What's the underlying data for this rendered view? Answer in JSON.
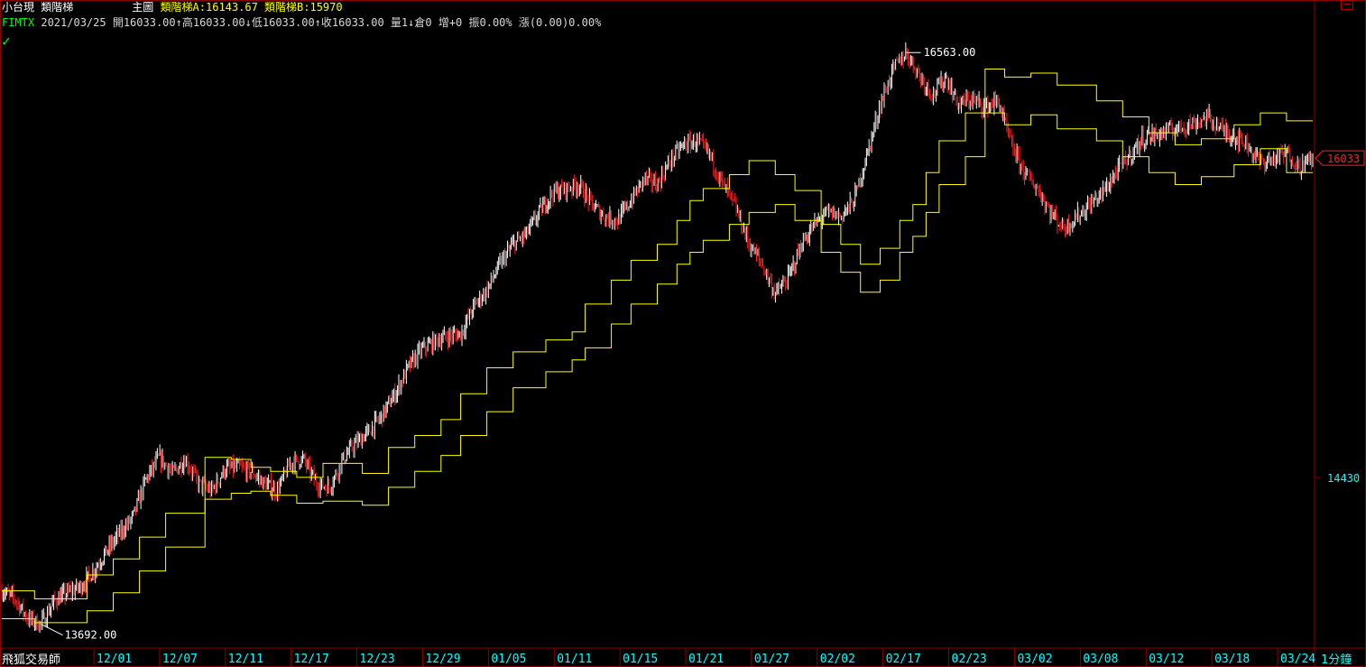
{
  "header": {
    "product": "小台現",
    "indicator_name": "類階梯",
    "main_chart_label": "主圖",
    "ladder_a_label": "類階梯A:",
    "ladder_a_value": "16143.67",
    "ladder_b_label": "類階梯B:",
    "ladder_b_value": "15970",
    "symbol": "FIMTX",
    "quote": "2021/03/25 開16033.00↑高16033.00↓低16033.00↑收16033.00 量1↓倉0 增+0 振0.00% 漲(0.00)0.00%"
  },
  "footer": {
    "brand": "飛狐交易師",
    "timeframe": "1分鐘"
  },
  "icons": {
    "status": "checkmark-icon",
    "window": "window-control-icon"
  },
  "colors": {
    "background": "#000000",
    "ladder_lines": "#ffff00",
    "candle_up": "#ffffff",
    "candle_down": "#ff2020",
    "axis_text": "#00ffff",
    "frame": "#8b0000",
    "price_tag": "#ff2020"
  },
  "chart_data": {
    "type": "line",
    "title": "",
    "symbol": "FIMTX",
    "x_tick_labels": [
      "12/01",
      "12/07",
      "12/11",
      "12/17",
      "12/23",
      "12/29",
      "01/05",
      "01/11",
      "01/15",
      "01/21",
      "01/27",
      "02/02",
      "02/17",
      "02/23",
      "03/02",
      "03/08",
      "03/12",
      "03/18",
      "03/24"
    ],
    "y_axis_labels": [
      "14430",
      "16033"
    ],
    "ylim": [
      13600,
      16700
    ],
    "grid": false,
    "annotations": {
      "high": "16563.00",
      "low": "13692.00",
      "last_price": "16033"
    },
    "close_path": {
      "x_index": [
        0,
        2,
        4,
        6,
        8,
        10,
        12,
        14,
        16,
        18,
        20,
        22,
        24,
        26,
        28,
        30,
        32,
        34,
        36,
        38,
        40,
        42,
        44,
        46,
        48,
        50,
        52,
        54,
        56,
        58,
        60,
        62,
        64,
        66,
        68,
        70,
        72,
        74,
        76,
        78,
        80,
        82,
        84,
        86,
        88,
        90,
        92,
        94,
        96,
        98,
        100,
        102,
        104,
        106,
        108,
        110,
        112,
        114,
        116,
        118,
        120,
        122,
        124,
        126,
        128,
        130,
        132,
        134,
        136,
        138,
        140,
        142,
        144,
        146,
        148,
        150,
        152,
        154,
        156,
        158,
        160,
        162,
        164,
        166,
        168,
        170,
        172,
        174,
        176,
        178,
        180,
        182,
        184,
        186,
        188,
        190,
        192,
        194,
        196,
        198,
        200
      ],
      "close": [
        13860,
        13820,
        13720,
        13692,
        13810,
        13850,
        13880,
        13960,
        14060,
        14150,
        14230,
        14420,
        14530,
        14450,
        14520,
        14400,
        14360,
        14470,
        14480,
        14460,
        14400,
        14360,
        14500,
        14520,
        14400,
        14380,
        14520,
        14600,
        14660,
        14740,
        14850,
        14980,
        15070,
        15110,
        15140,
        15150,
        15290,
        15370,
        15500,
        15600,
        15650,
        15760,
        15860,
        15880,
        15900,
        15800,
        15740,
        15720,
        15820,
        15930,
        15900,
        16020,
        16100,
        16120,
        16050,
        15900,
        15780,
        15600,
        15500,
        15350,
        15430,
        15600,
        15700,
        15760,
        15740,
        15820,
        16050,
        16300,
        16480,
        16563,
        16450,
        16350,
        16440,
        16300,
        16330,
        16290,
        16320,
        16100,
        15960,
        15880,
        15760,
        15680,
        15740,
        15800,
        15860,
        15960,
        16040,
        16130,
        16150,
        16170,
        16190,
        16210,
        16240,
        16180,
        16140,
        16100,
        16010,
        16030,
        16060,
        15990,
        16033
      ]
    },
    "series": [
      {
        "name": "類階梯A",
        "x_index": [
          0,
          5,
          5,
          13,
          13,
          17,
          17,
          21,
          21,
          25,
          25,
          31,
          31,
          35,
          35,
          38,
          38,
          41,
          41,
          45,
          45,
          49,
          49,
          55,
          55,
          59,
          59,
          63,
          63,
          67,
          67,
          70,
          70,
          74,
          74,
          78,
          78,
          83,
          83,
          87,
          87,
          89,
          89,
          93,
          93,
          96,
          96,
          100,
          100,
          103,
          103,
          105,
          105,
          107,
          107,
          111,
          111,
          114,
          114,
          118,
          118,
          121,
          121,
          125,
          125,
          128,
          128,
          131,
          131,
          134,
          134,
          137,
          137,
          139,
          139,
          141,
          141,
          143,
          143,
          147,
          147,
          150,
          150,
          153,
          153,
          157,
          157,
          161,
          161,
          167,
          167,
          171,
          171,
          175,
          175,
          179,
          179,
          183,
          183,
          188,
          188,
          192,
          192,
          196,
          196,
          200
        ],
        "values": [
          13860,
          13860,
          13820,
          13820,
          13940,
          13940,
          14020,
          14020,
          14130,
          14130,
          14250,
          14250,
          14530,
          14530,
          14520,
          14520,
          14480,
          14480,
          14460,
          14460,
          14430,
          14430,
          14500,
          14500,
          14450,
          14450,
          14580,
          14580,
          14640,
          14640,
          14720,
          14720,
          14850,
          14850,
          14980,
          14980,
          15060,
          15060,
          15120,
          15120,
          15160,
          15160,
          15300,
          15300,
          15420,
          15420,
          15520,
          15520,
          15600,
          15600,
          15720,
          15720,
          15820,
          15820,
          15880,
          15880,
          15950,
          15950,
          16020,
          16020,
          15950,
          15950,
          15870,
          15870,
          15700,
          15700,
          15600,
          15600,
          15500,
          15500,
          15580,
          15580,
          15720,
          15720,
          15800,
          15800,
          15960,
          15960,
          16120,
          16120,
          16260,
          16260,
          16480,
          16480,
          16440,
          16440,
          16460,
          16460,
          16400,
          16400,
          16320,
          16320,
          16240,
          16240,
          16160,
          16160,
          16100,
          16100,
          16130,
          16130,
          16200,
          16200,
          16260,
          16260,
          16220,
          16220
        ]
      },
      {
        "name": "類階梯B",
        "x_index": [
          0,
          5,
          5,
          13,
          13,
          17,
          17,
          21,
          21,
          25,
          25,
          31,
          31,
          35,
          35,
          38,
          38,
          41,
          41,
          45,
          45,
          49,
          49,
          55,
          55,
          59,
          59,
          63,
          63,
          67,
          67,
          70,
          70,
          74,
          74,
          78,
          78,
          83,
          83,
          87,
          87,
          89,
          89,
          93,
          93,
          96,
          96,
          100,
          100,
          103,
          103,
          105,
          105,
          107,
          107,
          111,
          111,
          114,
          114,
          118,
          118,
          121,
          121,
          125,
          125,
          128,
          128,
          131,
          131,
          134,
          134,
          137,
          137,
          139,
          139,
          141,
          141,
          143,
          143,
          147,
          147,
          150,
          150,
          153,
          153,
          157,
          157,
          161,
          161,
          167,
          167,
          171,
          171,
          175,
          175,
          179,
          179,
          183,
          183,
          188,
          188,
          192,
          192,
          196,
          196,
          200
        ],
        "values": [
          13720,
          13720,
          13700,
          13700,
          13760,
          13760,
          13850,
          13850,
          13960,
          13960,
          14080,
          14080,
          14320,
          14320,
          14350,
          14350,
          14360,
          14360,
          14340,
          14340,
          14300,
          14300,
          14310,
          14310,
          14290,
          14290,
          14380,
          14380,
          14460,
          14460,
          14540,
          14540,
          14640,
          14640,
          14760,
          14760,
          14880,
          14880,
          14960,
          14960,
          15020,
          15020,
          15080,
          15080,
          15200,
          15200,
          15300,
          15300,
          15400,
          15400,
          15500,
          15500,
          15560,
          15560,
          15620,
          15620,
          15700,
          15700,
          15760,
          15760,
          15800,
          15800,
          15720,
          15720,
          15560,
          15560,
          15460,
          15460,
          15360,
          15360,
          15420,
          15420,
          15560,
          15560,
          15640,
          15640,
          15760,
          15760,
          15900,
          15900,
          16040,
          16040,
          16260,
          16260,
          16200,
          16200,
          16250,
          16250,
          16180,
          16180,
          16120,
          16120,
          16040,
          16040,
          15960,
          15960,
          15900,
          15900,
          15940,
          15940,
          16000,
          16000,
          16080,
          16080,
          15960,
          15960
        ]
      }
    ]
  }
}
